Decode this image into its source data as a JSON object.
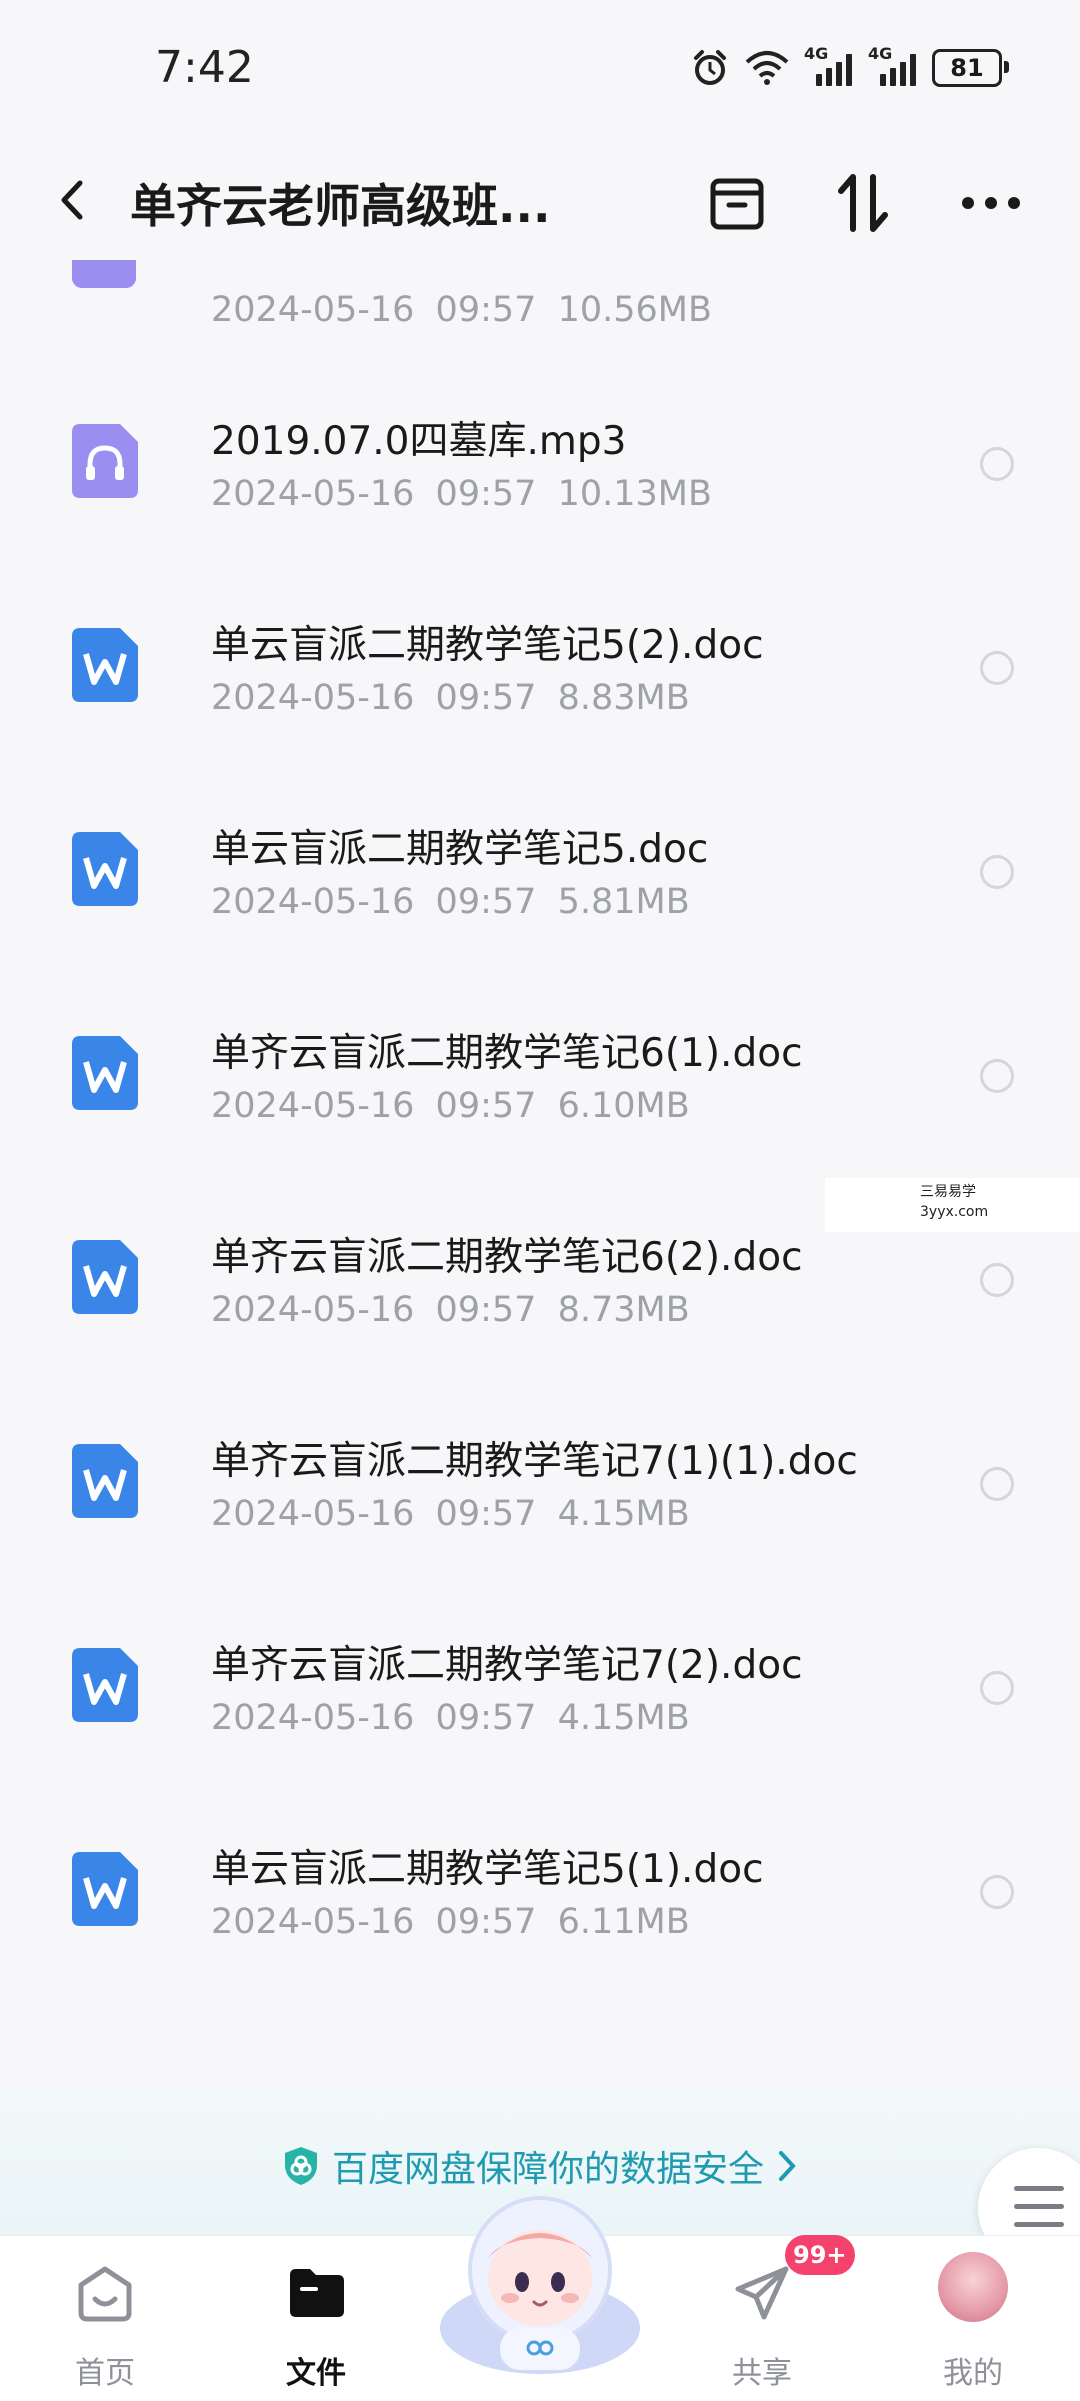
{
  "status_bar": {
    "time": "7:42",
    "net1": "4G",
    "net2": "4G",
    "battery": "81"
  },
  "header": {
    "title": "单齐云老师高级班..."
  },
  "files": [
    {
      "name": "",
      "date": "2024-05-16",
      "time": "09:57",
      "size": "10.56MB",
      "type": "audio",
      "partial": true
    },
    {
      "name": "2019.07.0四墓库.mp3",
      "date": "2024-05-16",
      "time": "09:57",
      "size": "10.13MB",
      "type": "audio"
    },
    {
      "name": "单云盲派二期教学笔记5(2).doc",
      "date": "2024-05-16",
      "time": "09:57",
      "size": "8.83MB",
      "type": "doc"
    },
    {
      "name": "单云盲派二期教学笔记5.doc",
      "date": "2024-05-16",
      "time": "09:57",
      "size": "5.81MB",
      "type": "doc"
    },
    {
      "name": "单齐云盲派二期教学笔记6(1).doc",
      "date": "2024-05-16",
      "time": "09:57",
      "size": "6.10MB",
      "type": "doc"
    },
    {
      "name": "单齐云盲派二期教学笔记6(2).doc",
      "date": "2024-05-16",
      "time": "09:57",
      "size": "8.73MB",
      "type": "doc"
    },
    {
      "name": "单齐云盲派二期教学笔记7(1)(1).doc",
      "date": "2024-05-16",
      "time": "09:57",
      "size": "4.15MB",
      "type": "doc"
    },
    {
      "name": "单齐云盲派二期教学笔记7(2).doc",
      "date": "2024-05-16",
      "time": "09:57",
      "size": "4.15MB",
      "type": "doc"
    },
    {
      "name": "单云盲派二期教学笔记5(1).doc",
      "date": "2024-05-16",
      "time": "09:57",
      "size": "6.11MB",
      "type": "doc"
    }
  ],
  "watermark": {
    "line1": "三易易学",
    "line2": "3yyx.com"
  },
  "banner": {
    "text": "百度网盘保障你的数据安全"
  },
  "nav": {
    "items": [
      {
        "label": "首页",
        "icon": "home-icon"
      },
      {
        "label": "文件",
        "icon": "folder-icon",
        "active": true
      },
      {
        "label": "共享",
        "icon": "share-icon",
        "badge": "99+"
      },
      {
        "label": "我的",
        "icon": "avatar"
      }
    ]
  },
  "colors": {
    "doc_icon": "#3a86e8",
    "audio_icon": "#9b8ef1",
    "accent": "#1f9bb0",
    "badge": "#f5426c"
  }
}
